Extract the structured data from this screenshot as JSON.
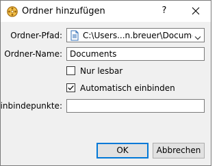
{
  "window": {
    "title": "Ordner hinzufügen",
    "help_glyph": "?"
  },
  "form": {
    "path": {
      "label": "Ordner-Pfad:",
      "value": "C:\\Users...n.breuer\\Documents"
    },
    "name": {
      "label": "Ordner-Name:",
      "value": "Documents"
    },
    "readonly": {
      "label": "Nur lesbar",
      "checked": false
    },
    "automount": {
      "label": "Automatisch einbinden",
      "checked": true
    },
    "mountpoint": {
      "label": "Einbindepunkte:",
      "value": ""
    }
  },
  "buttons": {
    "ok": "OK",
    "cancel": "Abbrechen"
  },
  "icons": {
    "app": "virtualbox-cube-icon",
    "path_type": "document-icon"
  },
  "colors": {
    "accent": "#0078d7",
    "titlebar_bg": "#ffffff",
    "window_bg": "#f0f0f0"
  }
}
